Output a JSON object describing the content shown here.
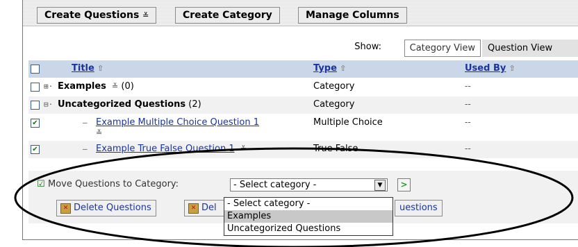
{
  "toolbar": {
    "create_questions": "Create Questions",
    "create_category": "Create Category",
    "manage_columns": "Manage Columns"
  },
  "view": {
    "show_label": "Show:",
    "category_view": "Category View",
    "question_view": "Question View"
  },
  "table": {
    "headers": {
      "title": "Title",
      "type": "Type",
      "used_by": "Used By"
    },
    "rows": [
      {
        "title": "Examples",
        "count": "(0)",
        "type": "Category",
        "used_by": "--"
      },
      {
        "title": "Uncategorized Questions",
        "count": "(2)",
        "type": "Category",
        "used_by": "--"
      },
      {
        "title": "Example Multiple Choice Question 1",
        "type": "Multiple Choice",
        "used_by": "--",
        "checked": true
      },
      {
        "title": "Example True False Question 1",
        "type": "True False",
        "used_by": "--",
        "checked": true
      }
    ]
  },
  "actions": {
    "move_label": "Move Questions to Category:",
    "select_value": "- Select category -",
    "delete_questions": "Delete Questions",
    "delete_truncated": "Del",
    "third_truncated": "uestions"
  },
  "dropdown": {
    "options": [
      "- Select category -",
      "Examples",
      "Uncategorized Questions"
    ],
    "selected_index": 1
  },
  "icons": [
    "menu-arrow-icon",
    "sort-up-icon",
    "expand-icon",
    "collapse-icon",
    "checkbox-icon",
    "dropdown-arrow-icon",
    "go-arrow-icon",
    "delete-icon"
  ]
}
